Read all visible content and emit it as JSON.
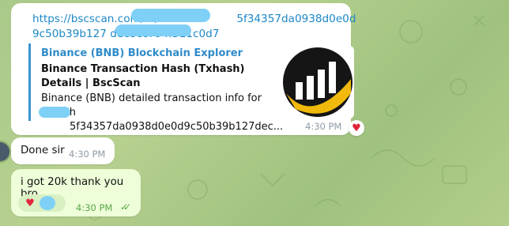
{
  "link_message": {
    "url_line1": "https://bscscan.com/tx/0x5f34357da0938d0e0d9c50b39b127",
    "url_line2": "dec8cc794f511c0d7",
    "url_display_line1_pre": "https://bscscan.com/tx/",
    "url_display_line1_post": "5f34357da0938d0e0d9c50b39b127",
    "url_display_line2": "dec8cc794f511c0d7",
    "preview": {
      "site_name": "Binance (BNB) Blockchain Explorer",
      "title": "Binance Transaction Hash (Txhash) Details | BscScan",
      "description_line1": "Binance (BNB) detailed transaction info for txhash",
      "description_line2": "5f34357da0938d0e0d9c50b39b127dec..."
    },
    "time": "4:30 PM",
    "reaction": "♥"
  },
  "incoming_message": {
    "text": "Done sir",
    "time": "4:30 PM"
  },
  "outgoing_message": {
    "text": "i got 20k thank you bro",
    "reaction": "♥",
    "time": "4:30 PM",
    "status": "✓✓"
  },
  "colors": {
    "link": "#1d88c7",
    "accent_bar": "#3e94cf",
    "redaction": "#7fd0f6",
    "outgoing_bg": "#eefed9",
    "heart": "#e0243a"
  }
}
